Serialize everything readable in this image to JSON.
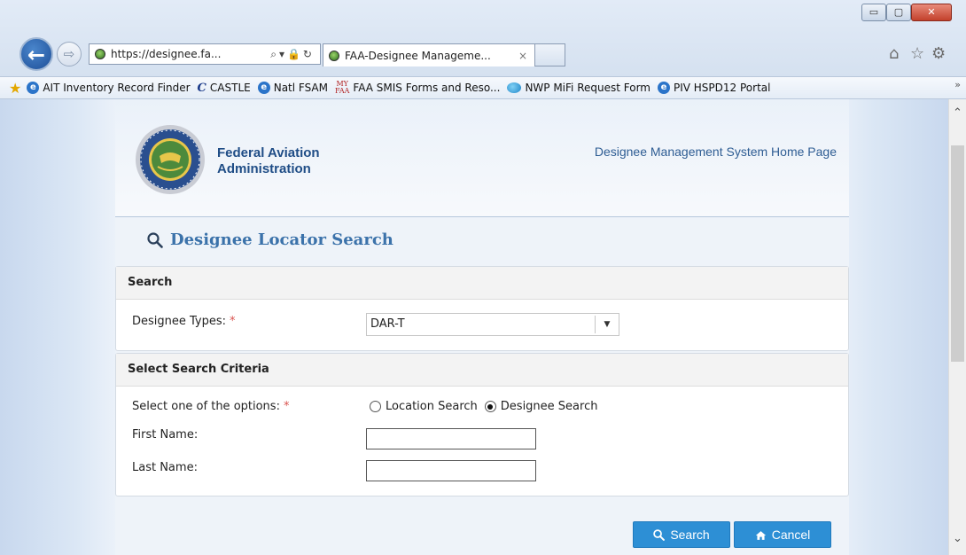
{
  "window": {
    "controls": {
      "minimize": "▭",
      "maximize": "▢",
      "close": "✕"
    }
  },
  "browser": {
    "address": "https://designee.fa...",
    "address_icons": "⌕▾🔒↻",
    "tab_title": "FAA-Designee Manageme...",
    "tab_close": "×",
    "nav_back": "←",
    "nav_forward": "⇨",
    "right_icons": {
      "home": "⌂",
      "favorites": "☆",
      "tools": "⚙"
    },
    "favorites": [
      {
        "label": "AIT Inventory Record Finder",
        "icon": "ie-icon"
      },
      {
        "label": "CASTLE",
        "icon": "castle-icon"
      },
      {
        "label": "Natl FSAM",
        "icon": "ie-icon"
      },
      {
        "label": "FAA SMIS Forms and Reso...",
        "icon": "myfaa-icon"
      },
      {
        "label": "NWP MiFi Request Form",
        "icon": "blue-blob-icon"
      },
      {
        "label": "PIV HSPD12 Portal",
        "icon": "ie-icon"
      }
    ],
    "favorites_more": "»"
  },
  "header": {
    "agency_line1": "Federal Aviation",
    "agency_line2": "Administration",
    "home_link": "Designee Management System Home Page"
  },
  "main": {
    "title": "Designee Locator Search",
    "search_panel": {
      "heading": "Search",
      "designee_types_label": "Designee Types:",
      "required_mark": "*",
      "designee_types_value": "DAR-T"
    },
    "criteria_panel": {
      "heading": "Select Search Criteria",
      "options_label": "Select one of the options:",
      "required_mark": "*",
      "option_location": "Location Search",
      "option_designee": "Designee Search",
      "selected_option": "Designee Search",
      "first_name_label": "First Name:",
      "first_name_value": "",
      "last_name_label": "Last Name:",
      "last_name_value": ""
    },
    "buttons": {
      "search": "Search",
      "cancel": "Cancel"
    }
  },
  "colors": {
    "accent": "#2d8fd5",
    "title_blue": "#3b72aa",
    "required_red": "#d9534f"
  }
}
